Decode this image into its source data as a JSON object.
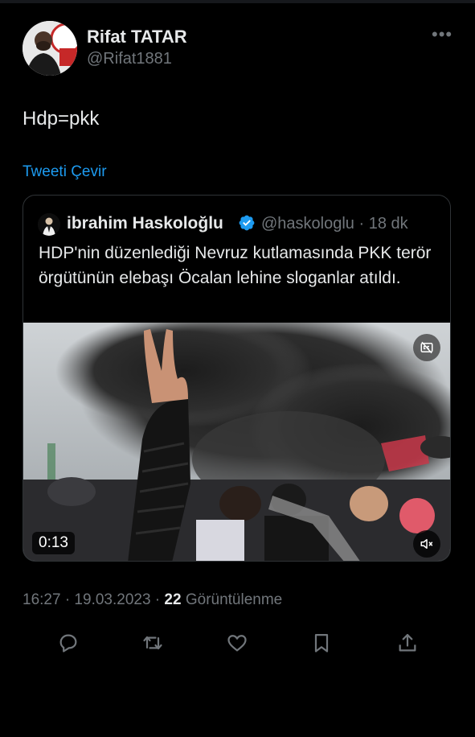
{
  "tweet": {
    "author_name": "Rifat TATAR",
    "author_handle": "@Rifat1881",
    "more_label": "•••",
    "text": "Hdp=pkk",
    "translate_label": "Tweeti Çevir"
  },
  "quoted_tweet": {
    "author_name": "ibrahim Haskoloğlu",
    "author_handle": "@haskologlu · 18 dk",
    "text": "HDP'nin düzenlediği Nevruz kutlamasında PKK terör örgütünün elebaşı Öcalan lehine sloganlar atıldı.",
    "video_time": "0:13"
  },
  "meta": {
    "timestamp": "16:27 · 19.03.2023 · ",
    "views_count": "22",
    "views_label": "Görüntülenme"
  },
  "colors": {
    "background": "#000000",
    "text": "#e7e9ea",
    "secondary": "#71767b",
    "link": "#1d9bf0",
    "verified": "#1d9bf0",
    "border": "#2f3336"
  },
  "actions": [
    "reply-icon",
    "retweet-icon",
    "like-icon",
    "bookmark-icon",
    "share-icon"
  ]
}
